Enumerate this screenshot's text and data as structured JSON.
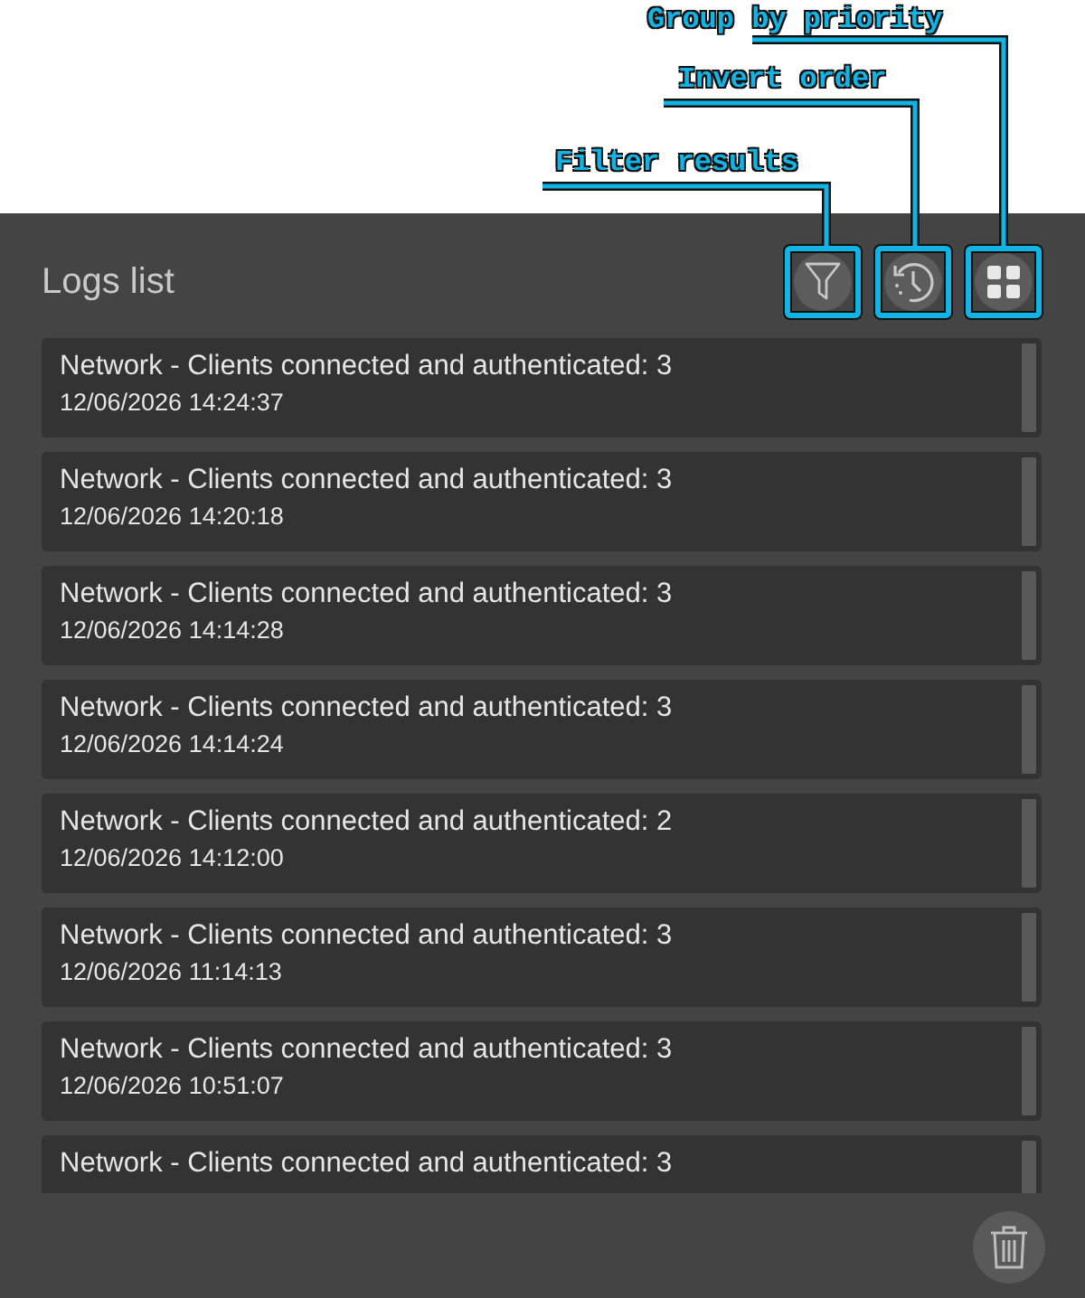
{
  "callouts": [
    {
      "label": "Group by priority"
    },
    {
      "label": "Invert order"
    },
    {
      "label": "Filter results"
    }
  ],
  "panel": {
    "title": "Logs list",
    "toolbar": [
      {
        "kind": "filter",
        "highlighted": true
      },
      {
        "kind": "history",
        "highlighted": true
      },
      {
        "kind": "group",
        "highlighted": true
      }
    ],
    "logs": [
      {
        "message": "Network - Clients connected and authenticated: 3",
        "time": "12/06/2026 14:24:37"
      },
      {
        "message": "Network - Clients connected and authenticated: 3",
        "time": "12/06/2026 14:20:18"
      },
      {
        "message": "Network - Clients connected and authenticated: 3",
        "time": "12/06/2026 14:14:28"
      },
      {
        "message": "Network - Clients connected and authenticated: 3",
        "time": "12/06/2026 14:14:24"
      },
      {
        "message": "Network - Clients connected and authenticated: 2",
        "time": "12/06/2026 14:12:00"
      },
      {
        "message": "Network - Clients connected and authenticated: 3",
        "time": "12/06/2026 11:14:13"
      },
      {
        "message": "Network - Clients connected and authenticated: 3",
        "time": "12/06/2026 10:51:07"
      },
      {
        "message": "Network - Clients connected and authenticated: 3"
      }
    ]
  }
}
